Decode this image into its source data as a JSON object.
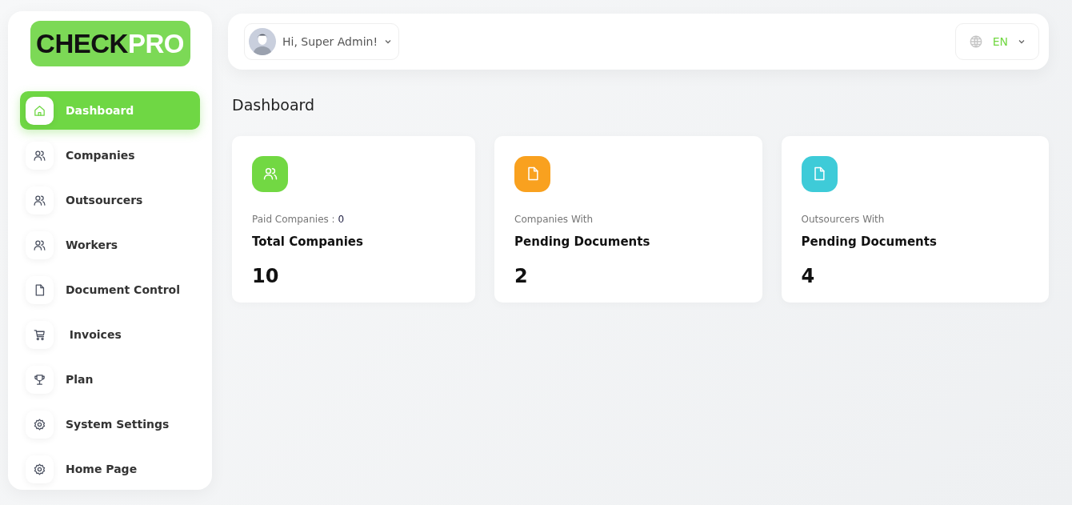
{
  "logo": {
    "dark": "CHECK",
    "light": "PRO"
  },
  "sidebar": {
    "items": [
      {
        "label": "Dashboard",
        "kind": "home",
        "selected": true
      },
      {
        "label": "Companies",
        "kind": "users",
        "selected": false
      },
      {
        "label": "Outsourcers",
        "kind": "users",
        "selected": false
      },
      {
        "label": "Workers",
        "kind": "users",
        "selected": false
      },
      {
        "label": "Document Control",
        "kind": "file",
        "selected": false
      },
      {
        "label": " Invoices",
        "kind": "cart",
        "selected": false
      },
      {
        "label": "Plan",
        "kind": "trophy",
        "selected": false
      },
      {
        "label": "System Settings",
        "kind": "gear",
        "selected": false
      },
      {
        "label": "Home Page",
        "kind": "gear",
        "selected": false
      }
    ]
  },
  "header": {
    "greeting": "Hi, Super Admin!",
    "language": "EN"
  },
  "page_title": "Dashboard",
  "cards": [
    {
      "kind": "users",
      "color": "#72d843",
      "subtitle": "Paid Companies : ",
      "subtitle_value": "0",
      "title": "Total Companies",
      "value": "10"
    },
    {
      "kind": "file",
      "color": "#f9a11f",
      "subtitle": "Companies With",
      "title": "Pending Documents",
      "value": "2"
    },
    {
      "kind": "file",
      "color": "#3ecbd8",
      "subtitle": "Outsourcers With",
      "title": "Pending Documents",
      "value": "4"
    }
  ]
}
